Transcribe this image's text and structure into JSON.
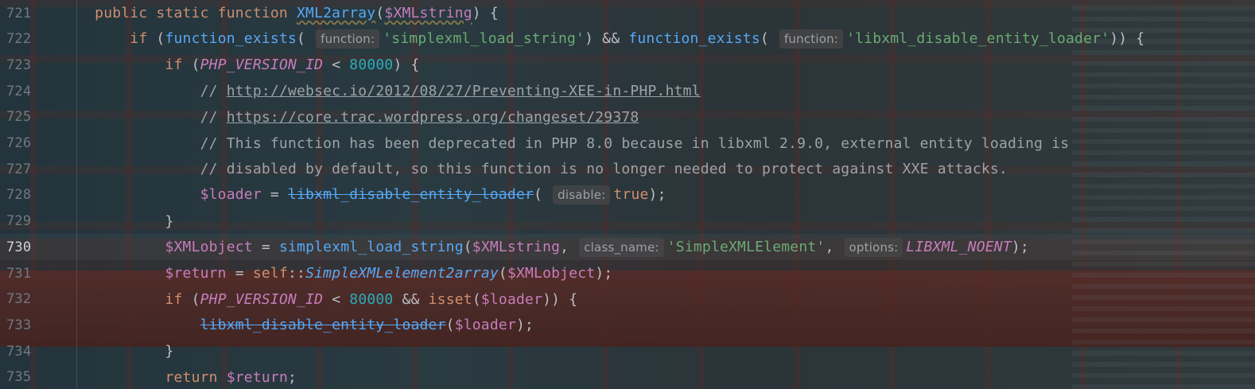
{
  "editor": {
    "current_line": 730,
    "lines": [
      {
        "number": "721",
        "indent": "    ",
        "tokens": [
          [
            "kw",
            "public static function "
          ],
          [
            "fn-decl",
            "XML2array"
          ],
          [
            "punc",
            "("
          ],
          [
            "var-wavy",
            "$XMLstring"
          ],
          [
            "punc",
            ") {"
          ]
        ]
      },
      {
        "number": "722",
        "indent": "        ",
        "tokens": [
          [
            "kw",
            "if "
          ],
          [
            "punc",
            "("
          ],
          [
            "fn",
            "function_exists"
          ],
          [
            "punc",
            "( "
          ],
          [
            "hint",
            "function:"
          ],
          [
            "str",
            "'simplexml_load_string'"
          ],
          [
            "punc",
            ") && "
          ],
          [
            "fn",
            "function_exists"
          ],
          [
            "punc",
            "( "
          ],
          [
            "hint",
            "function:"
          ],
          [
            "str",
            "'libxml_disable_entity_loader'"
          ],
          [
            "punc",
            "))"
          ],
          [
            "punc",
            " {"
          ]
        ]
      },
      {
        "number": "723",
        "indent": "            ",
        "tokens": [
          [
            "kw",
            "if "
          ],
          [
            "punc",
            "("
          ],
          [
            "const",
            "PHP_VERSION_ID"
          ],
          [
            "punc",
            " < "
          ],
          [
            "num",
            "80000"
          ],
          [
            "punc",
            ") {"
          ]
        ]
      },
      {
        "number": "724",
        "indent": "                ",
        "tokens": [
          [
            "comment",
            "// "
          ],
          [
            "link",
            "http://websec.io/2012/08/27/Preventing-XEE-in-PHP.html"
          ]
        ]
      },
      {
        "number": "725",
        "indent": "                ",
        "tokens": [
          [
            "comment",
            "// "
          ],
          [
            "link",
            "https://core.trac.wordpress.org/changeset/29378"
          ]
        ]
      },
      {
        "number": "726",
        "indent": "                ",
        "tokens": [
          [
            "comment",
            "// This function has been deprecated in PHP 8.0 because in libxml 2.9.0, external entity loading is"
          ]
        ]
      },
      {
        "number": "727",
        "indent": "                ",
        "tokens": [
          [
            "comment",
            "// disabled by default, so this function is no longer needed to protect against XXE attacks."
          ]
        ]
      },
      {
        "number": "728",
        "indent": "                ",
        "tokens": [
          [
            "var",
            "$loader"
          ],
          [
            "punc",
            " = "
          ],
          [
            "fn-dep",
            "libxml_disable_entity_loader"
          ],
          [
            "punc",
            "( "
          ],
          [
            "hint",
            "disable:"
          ],
          [
            "kw",
            "true"
          ],
          [
            "punc",
            ");"
          ]
        ]
      },
      {
        "number": "729",
        "indent": "            ",
        "tokens": [
          [
            "punc",
            "}"
          ]
        ]
      },
      {
        "number": "730",
        "indent": "            ",
        "tokens": [
          [
            "var",
            "$XMLobject"
          ],
          [
            "punc",
            " = "
          ],
          [
            "fn",
            "simplexml_load_string"
          ],
          [
            "punc",
            "("
          ],
          [
            "var",
            "$XMLstring"
          ],
          [
            "punc",
            ", "
          ],
          [
            "hint",
            "class_name:"
          ],
          [
            "str",
            "'SimpleXMLElement'"
          ],
          [
            "punc",
            ", "
          ],
          [
            "hint",
            "options:"
          ],
          [
            "const",
            "LIBXML_NOENT"
          ],
          [
            "punc",
            ");"
          ]
        ]
      },
      {
        "number": "731",
        "indent": "            ",
        "tokens": [
          [
            "var",
            "$return"
          ],
          [
            "punc",
            " = "
          ],
          [
            "kw",
            "self"
          ],
          [
            "punc",
            "::"
          ],
          [
            "static-call",
            "SimpleXMLelement2array"
          ],
          [
            "punc",
            "("
          ],
          [
            "var",
            "$XMLobject"
          ],
          [
            "punc",
            ");"
          ]
        ]
      },
      {
        "number": "732",
        "indent": "            ",
        "tokens": [
          [
            "kw",
            "if "
          ],
          [
            "punc",
            "("
          ],
          [
            "const",
            "PHP_VERSION_ID"
          ],
          [
            "punc",
            " < "
          ],
          [
            "num",
            "80000"
          ],
          [
            "punc",
            " && "
          ],
          [
            "kw",
            "isset"
          ],
          [
            "punc",
            "("
          ],
          [
            "var",
            "$loader"
          ],
          [
            "punc",
            ")) {"
          ]
        ]
      },
      {
        "number": "733",
        "indent": "                ",
        "tokens": [
          [
            "fn-dep",
            "libxml_disable_entity_loader"
          ],
          [
            "punc",
            "("
          ],
          [
            "var",
            "$loader"
          ],
          [
            "punc",
            ");"
          ]
        ]
      },
      {
        "number": "734",
        "indent": "            ",
        "tokens": [
          [
            "punc",
            "}"
          ]
        ]
      },
      {
        "number": "735",
        "indent": "            ",
        "tokens": [
          [
            "kw",
            "return "
          ],
          [
            "var",
            "$return"
          ],
          [
            "punc",
            ";"
          ]
        ]
      }
    ]
  },
  "colors": {
    "keyword": "#cf8e6d",
    "function": "#56a8f5",
    "variable": "#c77dbb",
    "string": "#6aab73",
    "number": "#2aacb8",
    "comment": "#9ca3a8",
    "hint_background": "#464648"
  }
}
